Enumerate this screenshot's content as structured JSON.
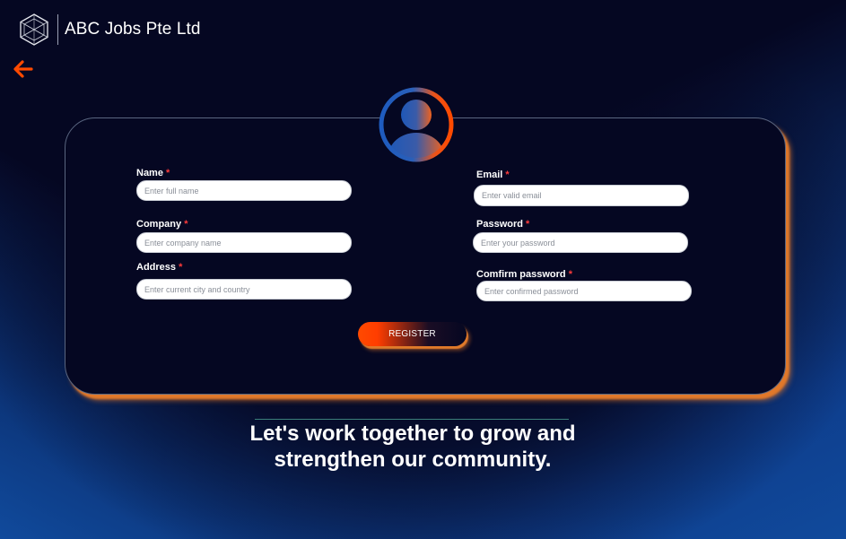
{
  "header": {
    "company_name": "ABC Jobs Pte Ltd",
    "logo_icon": "geometric-hexagon-logo"
  },
  "nav": {
    "back_icon": "arrow-left-icon"
  },
  "form": {
    "avatar_icon": "user-avatar-icon",
    "fields": {
      "name": {
        "label": "Name",
        "required_mark": "*",
        "placeholder": "Enter full name",
        "value": ""
      },
      "company": {
        "label": "Company",
        "required_mark": "*",
        "placeholder": "Enter company name",
        "value": ""
      },
      "address": {
        "label": "Address",
        "required_mark": "*",
        "placeholder": "Enter current city and country",
        "value": ""
      },
      "email": {
        "label": "Email",
        "required_mark": "*",
        "placeholder": "Enter valid email",
        "value": ""
      },
      "password": {
        "label": "Password",
        "required_mark": "*",
        "placeholder": "Enter your password",
        "value": ""
      },
      "confirm_password": {
        "label": "Comfirm password",
        "required_mark": "*",
        "placeholder": "Enter confirmed password",
        "value": ""
      }
    },
    "submit_label": "REGISTER"
  },
  "tagline": "Let's work together to grow and strengthen our community.",
  "colors": {
    "background": "#050722",
    "accent_orange": "#ff4a00",
    "card_glow": "#e0782a",
    "required": "#ff3b3b",
    "gradient_blue": "#0e3d8c"
  }
}
